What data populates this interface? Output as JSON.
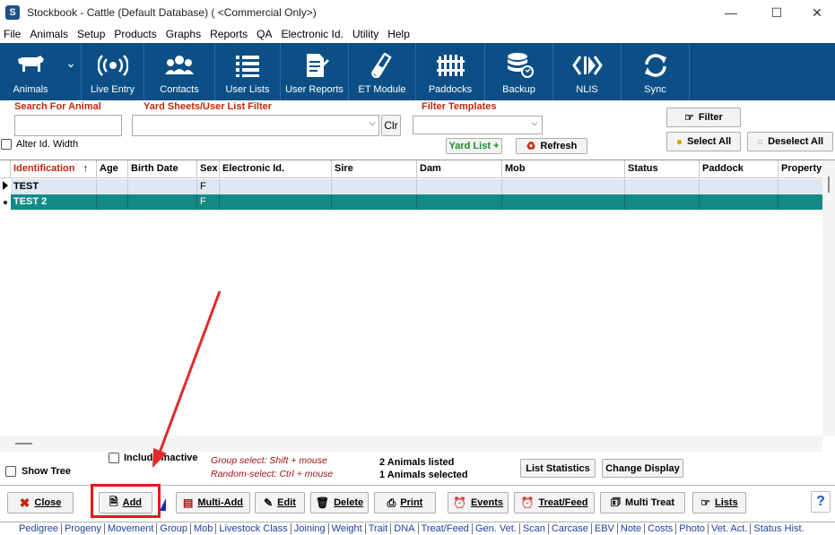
{
  "window": {
    "title": "Stockbook - Cattle (Default Database) ( <Commercial Only>)",
    "app_icon": "S"
  },
  "menu": [
    "File",
    "Animals",
    "Setup",
    "Products",
    "Graphs",
    "Reports",
    "QA",
    "Electronic Id.",
    "Utility",
    "Help"
  ],
  "toolbar": [
    "Animals",
    "Live Entry",
    "Contacts",
    "User Lists",
    "User Reports",
    "ET Module",
    "Paddocks",
    "Backup",
    "NLIS",
    "Sync"
  ],
  "filters": {
    "search_label": "Search For Animal",
    "yard_label": "Yard Sheets/User List Filter",
    "clr_label": "Clr",
    "templates_label": "Filter Templates",
    "alter_width_label": "Alter Id. Width",
    "yard_list_label": "Yard List +",
    "refresh_label": "Refresh",
    "filter_label": "Filter",
    "select_all_label": "Select All",
    "deselect_all_label": "Deselect All"
  },
  "grid": {
    "columns": [
      "Identification",
      "Age",
      "Birth Date",
      "Sex",
      "Electronic Id.",
      "Sire",
      "Dam",
      "Mob",
      "Status",
      "Paddock",
      "Property"
    ],
    "rows": [
      {
        "id": "TEST",
        "sex": "F"
      },
      {
        "id": "TEST 2",
        "sex": "F"
      }
    ]
  },
  "status": {
    "include_inactive": "Include Inactive",
    "show_tree": "Show Tree",
    "group_select": "Group select: Shift + mouse",
    "random_select": "Random-select: Ctrl + mouse",
    "listed": "2 Animals listed",
    "selected": "1 Animals selected",
    "list_statistics": "List Statistics",
    "change_display": "Change Display"
  },
  "actions": {
    "close": "Close",
    "add": "Add",
    "multi_add": "Multi-Add",
    "edit": "Edit",
    "delete": "Delete",
    "print": "Print",
    "events": "Events",
    "treat_feed": "Treat/Feed",
    "multi_treat": "Multi Treat",
    "lists": "Lists",
    "help": "?"
  },
  "tabs": [
    "Pedigree",
    "Progeny",
    "Movement",
    "Group",
    "Mob",
    "Livestock Class",
    "Joining",
    "Weight",
    "Trait",
    "DNA",
    "Treat/Feed",
    "Gen. Vet.",
    "Scan",
    "Carcase",
    "EBV",
    "Note",
    "Costs",
    "Photo",
    "Vet. Act.",
    "Status Hist."
  ],
  "colors": {
    "toolbar": "#0b4f86",
    "selected_row": "#138a86",
    "first_row": "#dde8f3",
    "highlight": "#e31a1a"
  }
}
